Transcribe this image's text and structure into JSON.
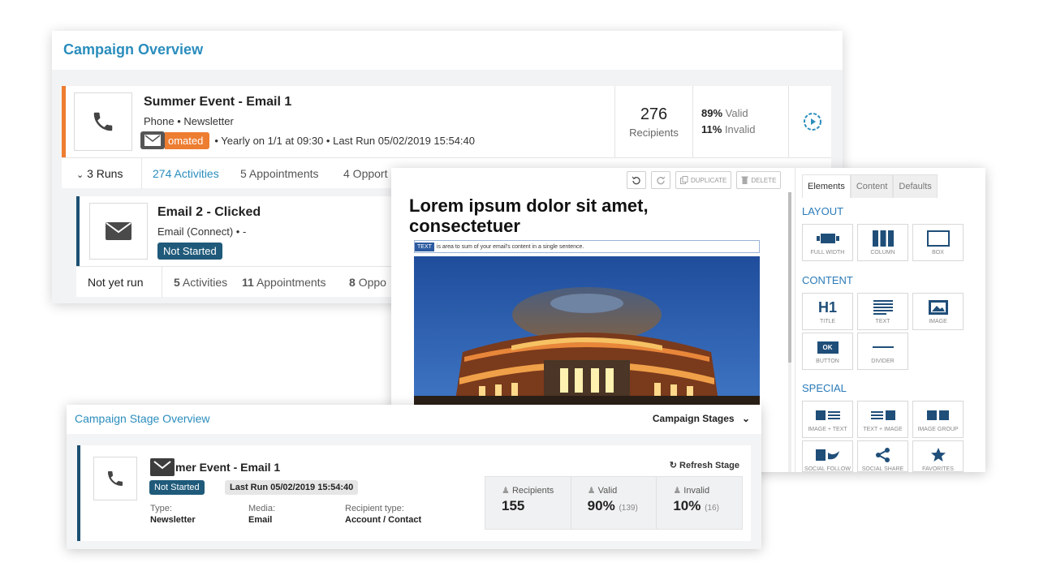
{
  "campaign_overview": {
    "title": "Campaign Overview",
    "run1": {
      "name": "Summer Event - Email 1",
      "meta": "Phone  • Newsletter",
      "badge": "omated",
      "schedule": "• Yearly on 1/1 at 09:30  • Last Run 05/02/2019 15:54:40",
      "recipients_value": "276",
      "recipients_label": "Recipients",
      "valid_pct": "89%",
      "valid_label": "Valid",
      "invalid_pct": "11%",
      "invalid_label": "Invalid"
    },
    "tabs1": {
      "runs": "3 Runs",
      "activities": "274 Activities",
      "appointments": "5 Appointments",
      "opportunities": "4 Opport"
    },
    "run2": {
      "name": "Email 2 - Clicked",
      "meta": "Email (Connect)  • -",
      "badge": "Not Started"
    },
    "tabs2": {
      "status": "Not yet run",
      "activities_count": "5",
      "activities_label": "Activities",
      "appointments_count": "11",
      "appointments_label": "Appointments",
      "opportunities_count": "8",
      "opportunities_label": "Oppo"
    }
  },
  "editor": {
    "toolbar": {
      "duplicate": "DUPLICATE",
      "delete": "DELETE"
    },
    "heading": "Lorem ipsum dolor sit amet, consectetuer",
    "text_tag": "TEXT",
    "text_line": "is area to sum of your email's content in a single sentence.",
    "panel": {
      "tabs": [
        "Elements",
        "Content",
        "Defaults"
      ],
      "layout_title": "LAYOUT",
      "layout_items": [
        "FULL WIDTH",
        "COLUMN",
        "BOX"
      ],
      "content_title": "CONTENT",
      "content_items": [
        "TITLE",
        "TEXT",
        "IMAGE",
        "BUTTON",
        "DIVIDER"
      ],
      "h1_glyph": "H1",
      "ok_glyph": "OK",
      "special_title": "SPECIAL",
      "special_items": [
        "IMAGE + TEXT",
        "TEXT + IMAGE",
        "IMAGE GROUP",
        "SOCIAL FOLLOW",
        "SOCIAL SHARE",
        "FAVORITES"
      ]
    }
  },
  "stage_overview": {
    "title": "Campaign Stage Overview",
    "dropdown": "Campaign Stages",
    "name": "mer Event - Email 1",
    "refresh": "Refresh Stage",
    "badge": "Not Started",
    "last_run": "Last Run 05/02/2019 15:54:40",
    "type_label": "Type:",
    "type_value": "Newsletter",
    "media_label": "Media:",
    "media_value": "Email",
    "recipient_type_label": "Recipient type:",
    "recipient_type_value": "Account / Contact",
    "stats": {
      "recipients_label": "Recipients",
      "recipients_value": "155",
      "valid_label": "Valid",
      "valid_value": "90%",
      "valid_count": "(139)",
      "invalid_label": "Invalid",
      "invalid_value": "10%",
      "invalid_count": "(16)"
    }
  },
  "colors": {
    "accent_blue": "#2a8dbd",
    "automated_orange": "#ed7d31",
    "badge_navy": "#1f5a7a"
  }
}
